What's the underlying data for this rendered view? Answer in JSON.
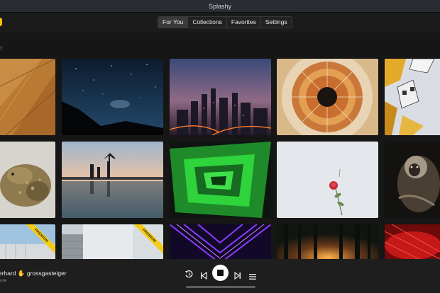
{
  "window": {
    "title": "Splashy"
  },
  "tabs": [
    {
      "label": "For You",
      "active": true
    },
    {
      "label": "Collections",
      "active": false
    },
    {
      "label": "Favorites",
      "active": false
    },
    {
      "label": "Settings",
      "active": false
    }
  ],
  "section": {
    "label_fragment": "d"
  },
  "premium_label": "PREMIUM",
  "player": {
    "author": "erhard ✋ grossgasteiger",
    "subtitle": "ure",
    "controls": [
      "history-icon",
      "previous-icon",
      "stop-icon",
      "next-icon",
      "queue-icon"
    ]
  },
  "photos": [
    {
      "name": "wood-panels",
      "premium": false
    },
    {
      "name": "night-sky-mountain",
      "premium": false
    },
    {
      "name": "city-skyline-dusk",
      "premium": false
    },
    {
      "name": "dome-ceiling",
      "premium": false
    },
    {
      "name": "cube-houses",
      "premium": false
    },
    {
      "name": "toad",
      "premium": false
    },
    {
      "name": "pier-silhouettes",
      "premium": false
    },
    {
      "name": "green-stairwell",
      "premium": false
    },
    {
      "name": "rose-on-white",
      "premium": false
    },
    {
      "name": "monkey",
      "premium": false
    },
    {
      "name": "white-building",
      "premium": true
    },
    {
      "name": "glass-facade",
      "premium": true
    },
    {
      "name": "purple-tunnel",
      "premium": false
    },
    {
      "name": "forest-sunset",
      "premium": false
    },
    {
      "name": "red-abstract",
      "premium": false
    }
  ],
  "colors": {
    "accent": "#f2c300",
    "background": "#161616",
    "premium": "#f3cc18"
  }
}
